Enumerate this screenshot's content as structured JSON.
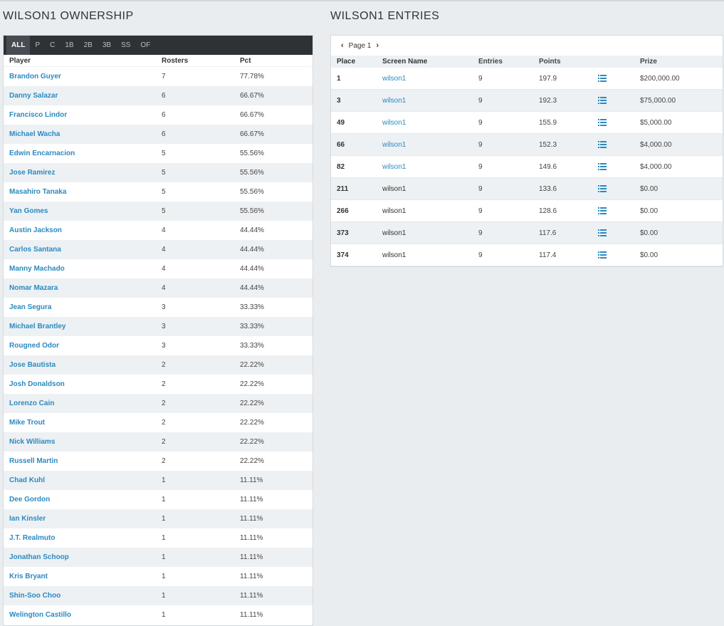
{
  "ownership": {
    "title": "WILSON1 OWNERSHIP",
    "tabs": [
      "ALL",
      "P",
      "C",
      "1B",
      "2B",
      "3B",
      "SS",
      "OF"
    ],
    "columns": {
      "player": "Player",
      "rosters": "Rosters",
      "pct": "Pct"
    },
    "rows": [
      {
        "player": "Brandon Guyer",
        "rosters": "7",
        "pct": "77.78%"
      },
      {
        "player": "Danny Salazar",
        "rosters": "6",
        "pct": "66.67%"
      },
      {
        "player": "Francisco Lindor",
        "rosters": "6",
        "pct": "66.67%"
      },
      {
        "player": "Michael Wacha",
        "rosters": "6",
        "pct": "66.67%"
      },
      {
        "player": "Edwin Encarnacion",
        "rosters": "5",
        "pct": "55.56%"
      },
      {
        "player": "Jose Ramirez",
        "rosters": "5",
        "pct": "55.56%"
      },
      {
        "player": "Masahiro Tanaka",
        "rosters": "5",
        "pct": "55.56%"
      },
      {
        "player": "Yan Gomes",
        "rosters": "5",
        "pct": "55.56%"
      },
      {
        "player": "Austin Jackson",
        "rosters": "4",
        "pct": "44.44%"
      },
      {
        "player": "Carlos Santana",
        "rosters": "4",
        "pct": "44.44%"
      },
      {
        "player": "Manny Machado",
        "rosters": "4",
        "pct": "44.44%"
      },
      {
        "player": "Nomar Mazara",
        "rosters": "4",
        "pct": "44.44%"
      },
      {
        "player": "Jean Segura",
        "rosters": "3",
        "pct": "33.33%"
      },
      {
        "player": "Michael Brantley",
        "rosters": "3",
        "pct": "33.33%"
      },
      {
        "player": "Rougned Odor",
        "rosters": "3",
        "pct": "33.33%"
      },
      {
        "player": "Jose Bautista",
        "rosters": "2",
        "pct": "22.22%"
      },
      {
        "player": "Josh Donaldson",
        "rosters": "2",
        "pct": "22.22%"
      },
      {
        "player": "Lorenzo Cain",
        "rosters": "2",
        "pct": "22.22%"
      },
      {
        "player": "Mike Trout",
        "rosters": "2",
        "pct": "22.22%"
      },
      {
        "player": "Nick Williams",
        "rosters": "2",
        "pct": "22.22%"
      },
      {
        "player": "Russell Martin",
        "rosters": "2",
        "pct": "22.22%"
      },
      {
        "player": "Chad Kuhl",
        "rosters": "1",
        "pct": "11.11%"
      },
      {
        "player": "Dee Gordon",
        "rosters": "1",
        "pct": "11.11%"
      },
      {
        "player": "Ian Kinsler",
        "rosters": "1",
        "pct": "11.11%"
      },
      {
        "player": "J.T. Realmuto",
        "rosters": "1",
        "pct": "11.11%"
      },
      {
        "player": "Jonathan Schoop",
        "rosters": "1",
        "pct": "11.11%"
      },
      {
        "player": "Kris Bryant",
        "rosters": "1",
        "pct": "11.11%"
      },
      {
        "player": "Shin-Soo Choo",
        "rosters": "1",
        "pct": "11.11%"
      },
      {
        "player": "Welington Castillo",
        "rosters": "1",
        "pct": "11.11%"
      }
    ]
  },
  "entries": {
    "title": "WILSON1 ENTRIES",
    "pager": {
      "label": "Page 1",
      "prev_icon": "chevron-left-icon",
      "next_icon": "chevron-right-icon"
    },
    "columns": {
      "place": "Place",
      "screen_name": "Screen Name",
      "entries": "Entries",
      "points": "Points",
      "prize": "Prize"
    },
    "rows": [
      {
        "place": "1",
        "screen_name": "wilson1",
        "linked": true,
        "entries": "9",
        "points": "197.9",
        "prize": "$200,000.00"
      },
      {
        "place": "3",
        "screen_name": "wilson1",
        "linked": true,
        "entries": "9",
        "points": "192.3",
        "prize": "$75,000.00"
      },
      {
        "place": "49",
        "screen_name": "wilson1",
        "linked": true,
        "entries": "9",
        "points": "155.9",
        "prize": "$5,000.00"
      },
      {
        "place": "66",
        "screen_name": "wilson1",
        "linked": true,
        "entries": "9",
        "points": "152.3",
        "prize": "$4,000.00"
      },
      {
        "place": "82",
        "screen_name": "wilson1",
        "linked": true,
        "entries": "9",
        "points": "149.6",
        "prize": "$4,000.00"
      },
      {
        "place": "211",
        "screen_name": "wilson1",
        "linked": false,
        "entries": "9",
        "points": "133.6",
        "prize": "$0.00"
      },
      {
        "place": "266",
        "screen_name": "wilson1",
        "linked": false,
        "entries": "9",
        "points": "128.6",
        "prize": "$0.00"
      },
      {
        "place": "373",
        "screen_name": "wilson1",
        "linked": false,
        "entries": "9",
        "points": "117.6",
        "prize": "$0.00"
      },
      {
        "place": "374",
        "screen_name": "wilson1",
        "linked": false,
        "entries": "9",
        "points": "117.4",
        "prize": "$0.00"
      }
    ]
  },
  "colors": {
    "link": "#2b8ac0",
    "tab_bar": "#2d3236",
    "row_alt": "#edf1f4",
    "page_bg": "#e9edf0"
  }
}
